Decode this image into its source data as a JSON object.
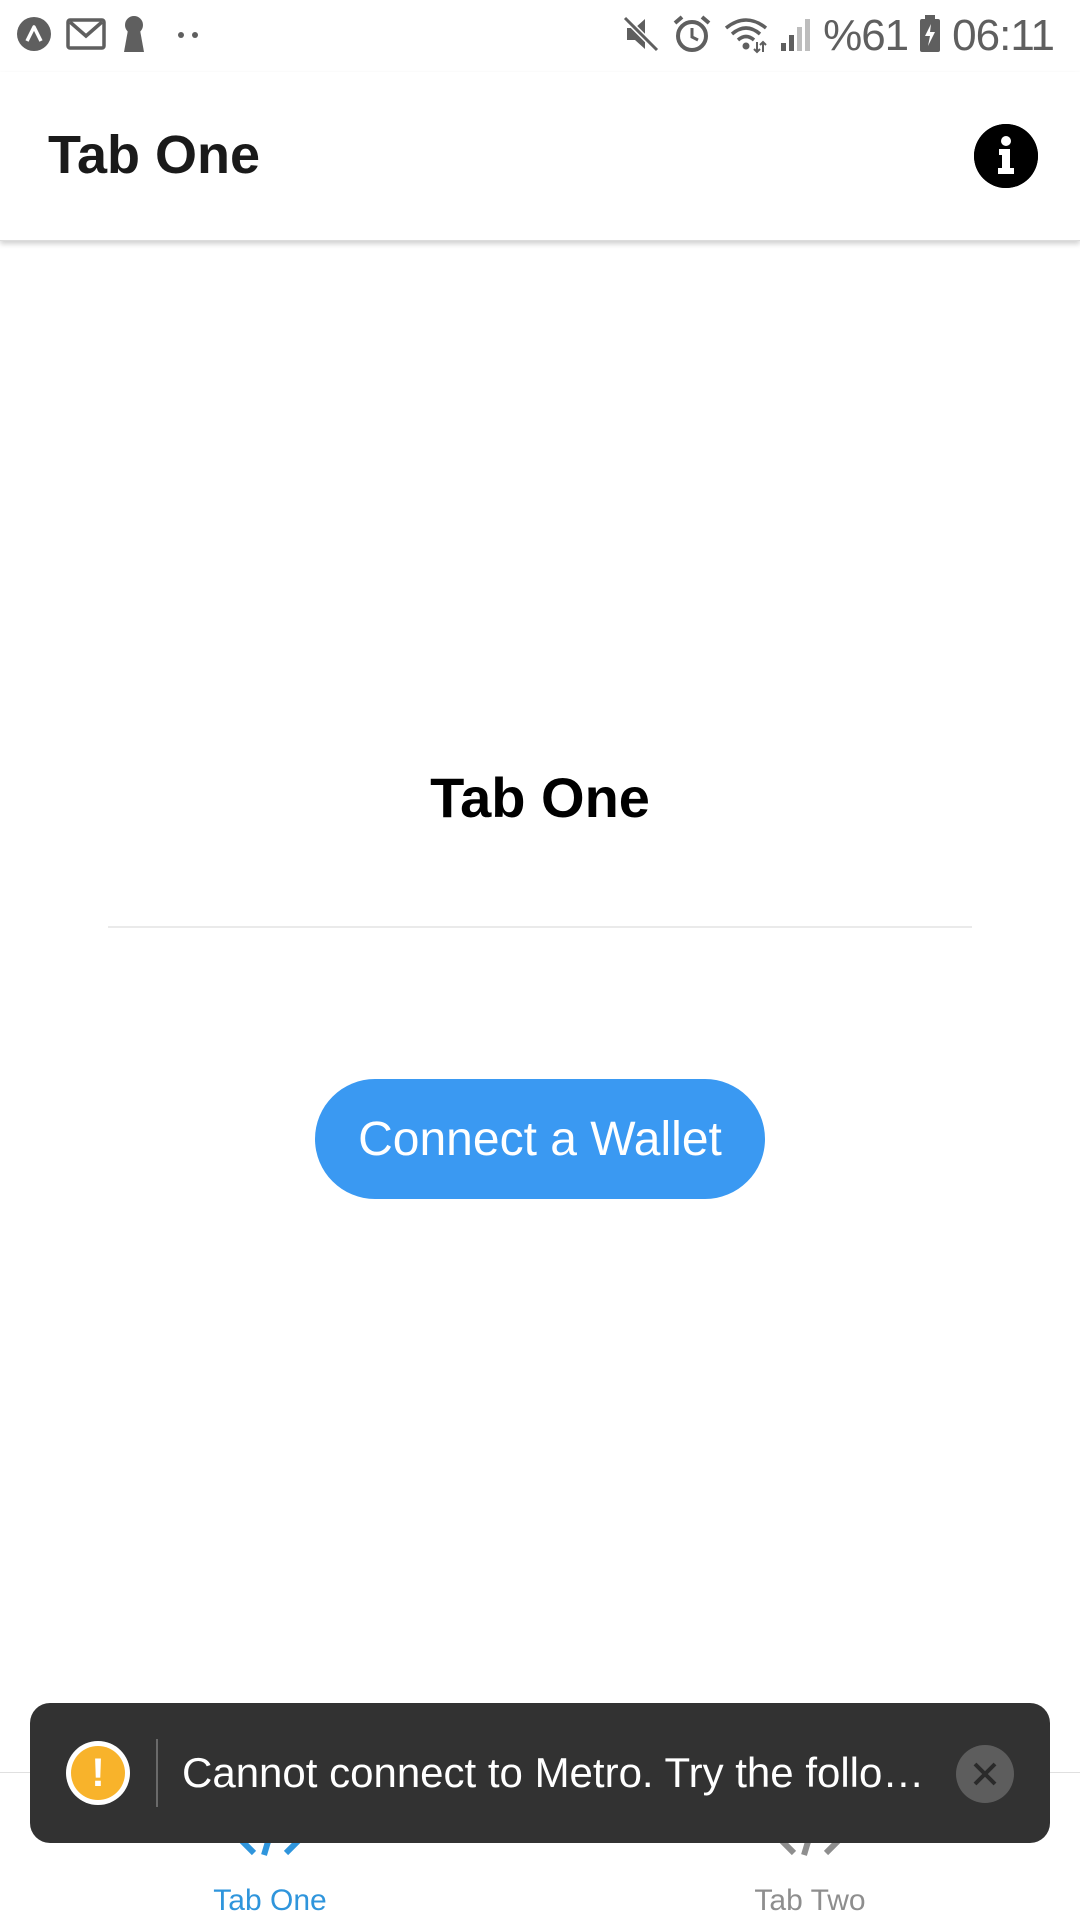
{
  "status_bar": {
    "battery_percent": "%61",
    "time": "06:11",
    "left_icons": [
      "expo-icon",
      "gmail-icon",
      "keyhole-icon",
      "more-dots-icon"
    ],
    "right_icons": [
      "mute-icon",
      "alarm-icon",
      "wifi-icon",
      "signal-icon",
      "battery-charging-icon"
    ]
  },
  "header": {
    "title": "Tab One",
    "info_icon": "info-icon"
  },
  "main": {
    "title": "Tab One",
    "connect_button_label": "Connect a Wallet",
    "connect_button_color": "#3a99f2"
  },
  "tab_bar": {
    "tabs": [
      {
        "label": "Tab One",
        "icon": "code-icon",
        "active": true,
        "color": "#2f95dc"
      },
      {
        "label": "Tab Two",
        "icon": "code-icon",
        "active": false,
        "color": "#8e8e8e"
      }
    ]
  },
  "toast": {
    "icon": "warning-icon",
    "message": "Cannot connect to Metro.  Try the follo…",
    "close_icon": "close-icon",
    "warning_color": "#f8b32b"
  }
}
